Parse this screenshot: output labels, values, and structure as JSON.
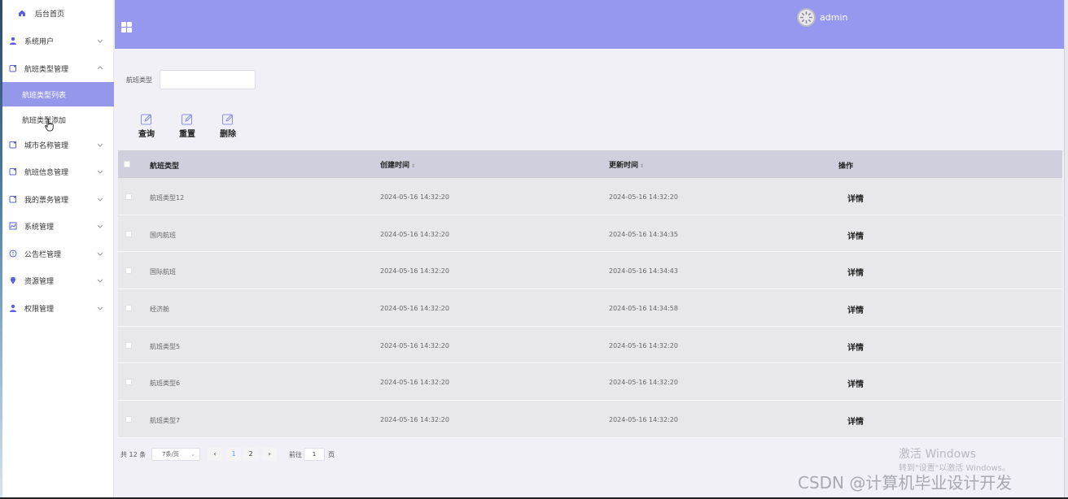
{
  "sidebar": {
    "home": "后台首页",
    "items": [
      {
        "label": "系统用户"
      },
      {
        "label": "航班类型管理"
      },
      {
        "label": "城市名称管理"
      },
      {
        "label": "航班信息管理"
      },
      {
        "label": "我的票务管理"
      },
      {
        "label": "系统管理"
      },
      {
        "label": "公告栏管理"
      },
      {
        "label": "资源管理"
      },
      {
        "label": "权限管理"
      }
    ],
    "sub_items": [
      {
        "label": "航班类型列表",
        "active": true
      },
      {
        "label": "航班类型添加",
        "active": false
      }
    ],
    "accent_color": "#9598ea"
  },
  "header": {
    "username": "admin",
    "bg_color": "#9598ee"
  },
  "search": {
    "label": "航班类型",
    "value": ""
  },
  "actions": {
    "query": "查询",
    "reset": "重置",
    "delete": "删除"
  },
  "table": {
    "headers": {
      "type": "航班类型",
      "created": "创建时间",
      "updated": "更新时间",
      "ops": "操作"
    },
    "rows": [
      {
        "type": "航班类型12",
        "created": "2024-05-16 14:32:20",
        "updated": "2024-05-16 14:32:20",
        "op": "详情"
      },
      {
        "type": "国内航班",
        "created": "2024-05-16 14:32:20",
        "updated": "2024-05-16 14:34:35",
        "op": "详情"
      },
      {
        "type": "国际航班",
        "created": "2024-05-16 14:32:20",
        "updated": "2024-05-16 14:34:43",
        "op": "详情"
      },
      {
        "type": "经济舱",
        "created": "2024-05-16 14:32:20",
        "updated": "2024-05-16 14:34:58",
        "op": "详情"
      },
      {
        "type": "航班类型5",
        "created": "2024-05-16 14:32:20",
        "updated": "2024-05-16 14:32:20",
        "op": "详情"
      },
      {
        "type": "航班类型6",
        "created": "2024-05-16 14:32:20",
        "updated": "2024-05-16 14:32:20",
        "op": "详情"
      },
      {
        "type": "航班类型7",
        "created": "2024-05-16 14:32:20",
        "updated": "2024-05-16 14:32:20",
        "op": "详情"
      }
    ]
  },
  "pagination": {
    "total": "共 12 条",
    "page_size": "7条/页",
    "prev": "‹",
    "pages": [
      "1",
      "2"
    ],
    "current": "1",
    "next": "›",
    "goto_label": "前往",
    "goto_value": "1",
    "page_unit": "页"
  },
  "watermark": {
    "activate_title": "激活 Windows",
    "activate_sub": "转到\"设置\"以激活 Windows。",
    "csdn": "CSDN @计算机毕业设计开发"
  }
}
